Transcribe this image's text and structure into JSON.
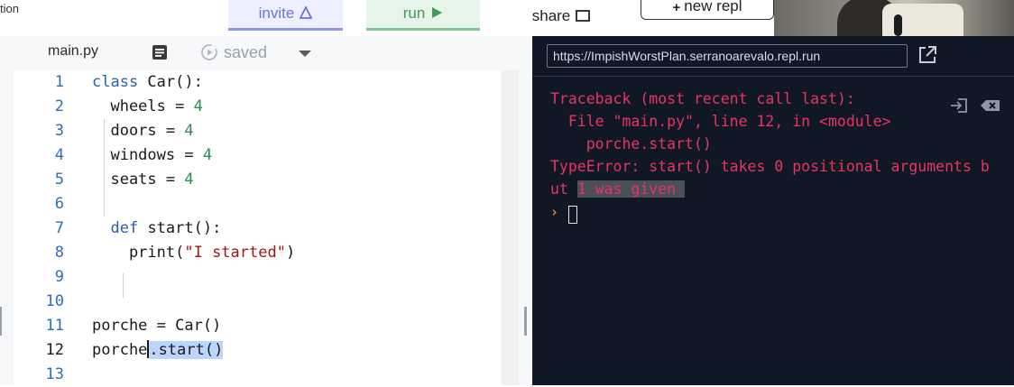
{
  "toolbar": {
    "left_text": "tion",
    "invite_label": "invite",
    "run_label": "run",
    "share_label": "share",
    "new_repl_label": "new repl",
    "new_repl_icon": "plus-icon",
    "colors": {
      "invite": "#6b74d8",
      "run": "#3e9c5a"
    }
  },
  "editor": {
    "file_tab": "main.py",
    "saved_label": "saved",
    "lines": [
      {
        "n": "1",
        "segments": [
          {
            "t": "class ",
            "c": "kw"
          },
          {
            "t": "Car():",
            "c": ""
          }
        ]
      },
      {
        "n": "2",
        "segments": [
          {
            "t": "  wheels = ",
            "c": ""
          },
          {
            "t": "4",
            "c": "num"
          }
        ]
      },
      {
        "n": "3",
        "segments": [
          {
            "t": "  doors = ",
            "c": ""
          },
          {
            "t": "4",
            "c": "num"
          }
        ]
      },
      {
        "n": "4",
        "segments": [
          {
            "t": "  windows = ",
            "c": ""
          },
          {
            "t": "4",
            "c": "num"
          }
        ]
      },
      {
        "n": "5",
        "segments": [
          {
            "t": "  seats = ",
            "c": ""
          },
          {
            "t": "4",
            "c": "num"
          }
        ]
      },
      {
        "n": "6",
        "segments": []
      },
      {
        "n": "7",
        "segments": [
          {
            "t": "  ",
            "c": ""
          },
          {
            "t": "def ",
            "c": "kw"
          },
          {
            "t": "start():",
            "c": ""
          }
        ]
      },
      {
        "n": "8",
        "segments": [
          {
            "t": "    print(",
            "c": ""
          },
          {
            "t": "\"I started\"",
            "c": "str"
          },
          {
            "t": ")",
            "c": ""
          }
        ]
      },
      {
        "n": "9",
        "segments": []
      },
      {
        "n": "10",
        "segments": []
      },
      {
        "n": "11",
        "segments": [
          {
            "t": "porche = Car()",
            "c": ""
          }
        ]
      },
      {
        "n": "12",
        "segments": [
          {
            "t": "porche",
            "c": ""
          },
          {
            "t": "CURSOR",
            "c": "cursor"
          },
          {
            "t": ".start()",
            "c": "sel"
          }
        ],
        "active": true
      },
      {
        "n": "13",
        "segments": []
      }
    ]
  },
  "console": {
    "url": "https://ImpishWorstPlan.serranoarevalo.repl.run",
    "output_lines": [
      "Traceback (most recent call last):",
      "  File \"main.py\", line 12, in <module>",
      "    porche.start()",
      "TypeError: start() takes 0 positional arguments b",
      "ut "
    ],
    "highlighted_tail": "1 was given ",
    "prompt_symbol": "›",
    "error_color": "#e8345f",
    "background": "#101826"
  }
}
